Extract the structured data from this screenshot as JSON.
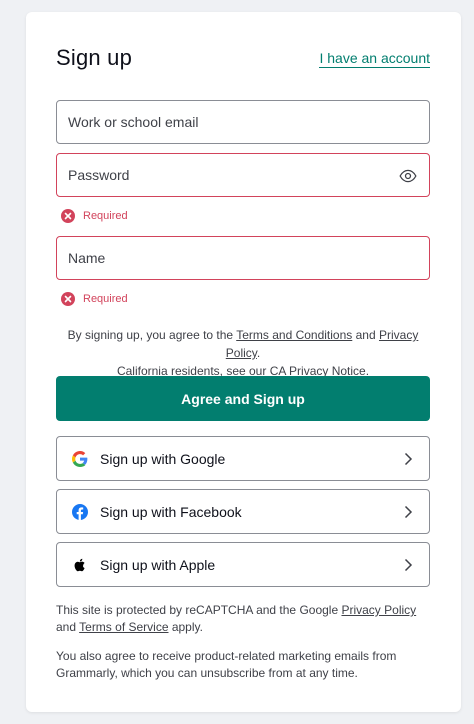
{
  "header": {
    "title": "Sign up",
    "have_account": "I have an account"
  },
  "form": {
    "email_placeholder": "Work or school email",
    "password_placeholder": "Password",
    "name_placeholder": "Name",
    "password_error": "Required",
    "name_error": "Required"
  },
  "legal": {
    "part1": "By signing up, you agree to the ",
    "terms": "Terms and Conditions",
    "and": " and ",
    "privacy": "Privacy Policy",
    "period1": ".",
    "part2": "California residents, see our ",
    "ca_notice": "CA Privacy Notice",
    "period2": "."
  },
  "primary_button": "Agree and Sign up",
  "social": [
    {
      "label": "Sign up with Google",
      "icon": "google-icon"
    },
    {
      "label": "Sign up with Facebook",
      "icon": "facebook-icon"
    },
    {
      "label": "Sign up with Apple",
      "icon": "apple-icon"
    }
  ],
  "recaptcha": {
    "part1": "This site is protected by reCAPTCHA and the Google ",
    "privacy": "Privacy Policy",
    "and": " and ",
    "terms": "Terms of Service",
    "part2": " apply."
  },
  "marketing_note": "You also agree to receive product-related marketing emails from Grammarly, which you can unsubscribe from at any time.",
  "colors": {
    "accent": "#027e6f",
    "error": "#d2435b",
    "background": "#eff1f4"
  }
}
